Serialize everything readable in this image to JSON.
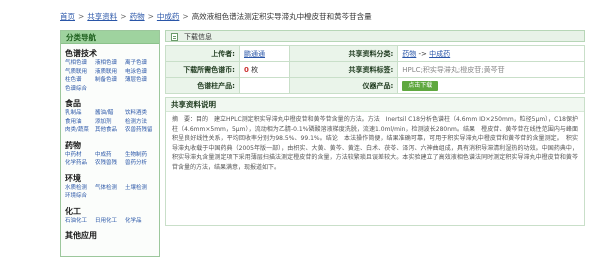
{
  "breadcrumb": {
    "items": [
      "首页",
      "共享资料",
      "药物",
      "中成药"
    ],
    "current": "高效液相色谱法测定积实导滞丸中橙皮苷和黄芩苷含量",
    "separator": ">"
  },
  "sidebar": {
    "title": "分类导航",
    "categories": [
      {
        "name": "色谱技术",
        "items": [
          "气相色谱",
          "液相色谱",
          "离子色谱",
          "气质联用",
          "液质联用",
          "电泳色谱",
          "柱色谱",
          "制备色谱",
          "薄层色谱",
          "色谱综合"
        ]
      },
      {
        "name": "食品",
        "items": [
          "乳制品",
          "酱油/醋",
          "饮料酒类",
          "食用油",
          "添加剂",
          "检测方法",
          "肉类/蔬菜",
          "其他食品",
          "农兽药残留"
        ]
      },
      {
        "name": "药物",
        "items": [
          "中药材",
          "中成药",
          "生物制药",
          "化学药品",
          "农残兽残",
          "兽药分析"
        ]
      },
      {
        "name": "环境",
        "items": [
          "水质检测",
          "气体检测",
          "土壤检测",
          "环境综合"
        ]
      },
      {
        "name": "化工",
        "items": [
          "石油化工",
          "日用化工",
          "化学品"
        ]
      },
      {
        "name": "其他应用",
        "items": []
      }
    ]
  },
  "panel": {
    "title": "下载信息"
  },
  "info": {
    "uploader_label": "上传者:",
    "uploader": "鹏通通",
    "category_label": "共享资料分类:",
    "category_link1": "药物",
    "category_sep": " -> ",
    "category_link2": "中成药",
    "download_label": "下载所需色谱币:",
    "download_value": "0",
    "download_unit": "枚",
    "keywords_label": "共享资料标签:",
    "keywords": "HPLC;积实导滞丸;橙皮苷;黄芩苷",
    "column_label": "色谱柱产品:",
    "column_value": "",
    "instrument_label": "仪器产品:",
    "instrument_value": "点击下载"
  },
  "description": {
    "title": "共享资料说明",
    "text": "摘　要：目的　建立HPLC测定积实导滞丸中橙皮苷和黄芩苷含量的方法。方法　Inertsil C18分析色谱柱（4.6mm ID×250mm，粒径5μm），C18保护柱（4.6mm×5mm，5μm），流动相为乙腈-0.1%磷酸溶液梯度洗脱，流速1.0ml/min，检测波长280nm。结果　橙皮苷、黄芩苷在线性范围内与峰面积呈良好线性关系，平均回收率分别为98.5%、99.1%。结论　本法操作简便，结果准确可靠，可用于积实导滞丸中橙皮苷和黄芩苷的含量测定。　积实导滞丸收载于中国药典（2005年版一部），由枳实、大黄、黄芩、黄连、白术、茯苓、泽泻、六神曲组成，具有消积导滞清利湿热的功效。中国药典中，积实导滞丸含量测定项下采用薄层扫描法测定橙皮苷的含量，方法较繁琐且误差较大。本实验建立了高效液相色谱法同时测定积实导滞丸中橙皮苷和黄芩苷含量的方法，结果满意，现报道如下。"
  }
}
